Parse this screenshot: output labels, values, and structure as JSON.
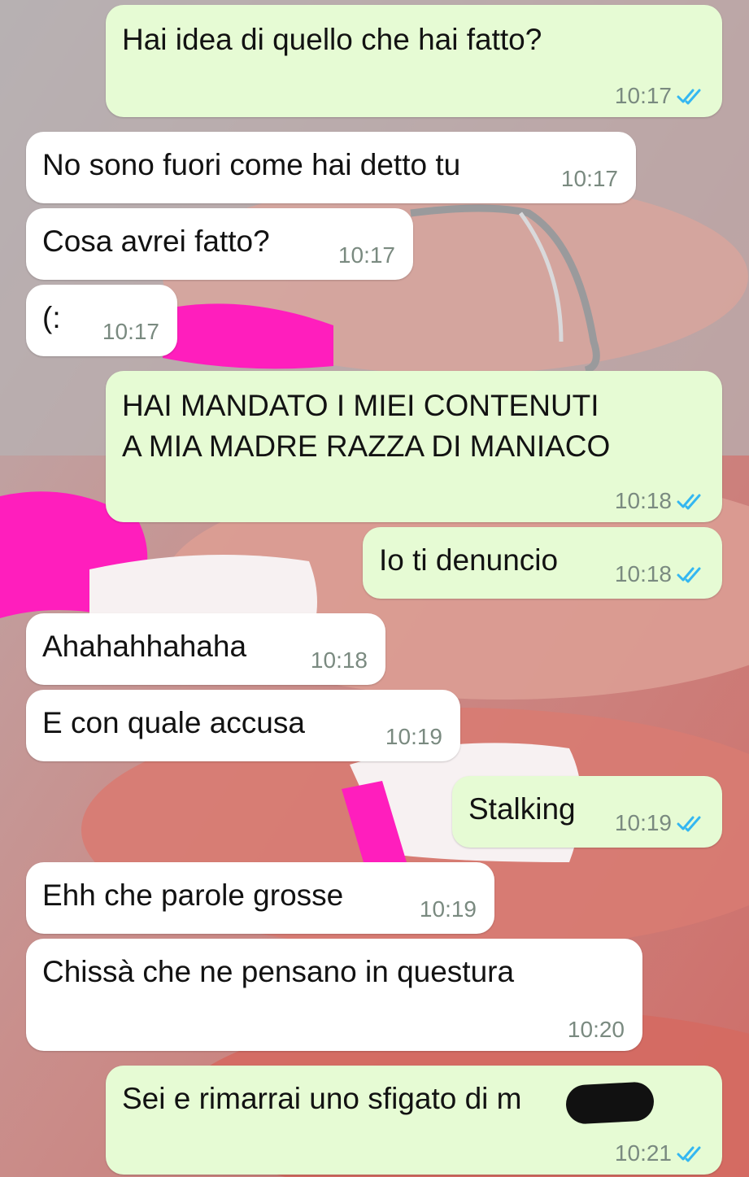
{
  "chat": {
    "messages": [
      {
        "dir": "out",
        "text": "Hai idea di quello che hai fatto?",
        "time": "10:17",
        "read": true
      },
      {
        "dir": "in",
        "text": "No sono fuori come hai detto tu",
        "time": "10:17"
      },
      {
        "dir": "in",
        "text": "Cosa avrei fatto?",
        "time": "10:17"
      },
      {
        "dir": "in",
        "text": "(:",
        "time": "10:17"
      },
      {
        "dir": "out",
        "text": "HAI MANDATO I MIEI CONTENUTI\nA MIA MADRE RAZZA DI MANIACO",
        "time": "10:18",
        "read": true
      },
      {
        "dir": "out",
        "text": "Io ti denuncio",
        "time": "10:18",
        "read": true
      },
      {
        "dir": "in",
        "text": "Ahahahhahaha",
        "time": "10:18"
      },
      {
        "dir": "in",
        "text": "E con quale accusa",
        "time": "10:19"
      },
      {
        "dir": "out",
        "text": "Stalking",
        "time": "10:19",
        "read": true
      },
      {
        "dir": "in",
        "text": "Ehh che parole grosse",
        "time": "10:19"
      },
      {
        "dir": "in",
        "text": "Chissà che ne pensano in questura",
        "time": "10:20"
      },
      {
        "dir": "out",
        "text": "Sei e rimarrai uno sfigato di m",
        "time": "10:21",
        "read": true
      }
    ]
  },
  "icons": {
    "read_receipt": "double-check-icon"
  },
  "colors": {
    "outgoing_bubble": "#e6fbd4",
    "incoming_bubble": "#ffffff",
    "read_ticks": "#34b7f1"
  }
}
